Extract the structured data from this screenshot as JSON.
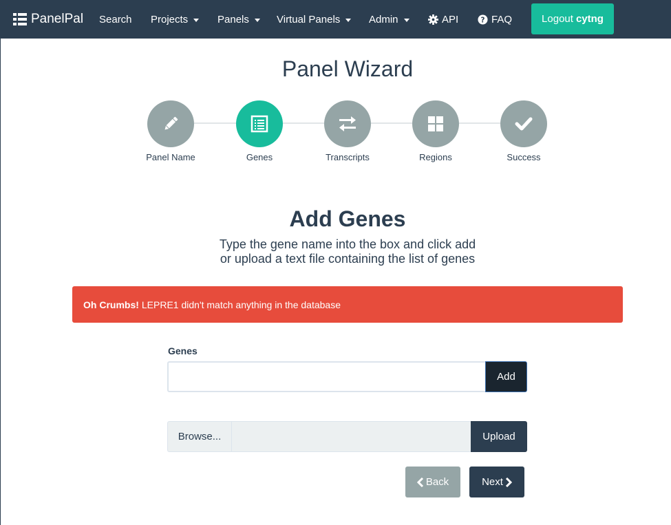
{
  "navbar": {
    "brand": "PanelPal",
    "search": "Search",
    "projects": "Projects",
    "panels": "Panels",
    "virtual_panels": "Virtual Panels",
    "admin": "Admin",
    "api": "API",
    "faq": "FAQ",
    "logout_prefix": "Logout",
    "username": "cytng"
  },
  "wizard": {
    "title": "Panel Wizard",
    "steps": [
      {
        "label": "Panel Name",
        "icon": "pencil-icon",
        "active": false
      },
      {
        "label": "Genes",
        "icon": "list-icon",
        "active": true
      },
      {
        "label": "Transcripts",
        "icon": "exchange-icon",
        "active": false
      },
      {
        "label": "Regions",
        "icon": "grid-icon",
        "active": false
      },
      {
        "label": "Success",
        "icon": "check-icon",
        "active": false
      }
    ]
  },
  "section": {
    "title": "Add Genes",
    "desc_line1": "Type the gene name into the box and click add",
    "desc_line2": "or upload a text file containing the list of genes"
  },
  "alert": {
    "strong": "Oh Crumbs!",
    "message": "LEPRE1 didn't match anything in the database"
  },
  "form": {
    "genes_label": "Genes",
    "genes_value": "",
    "add_label": "Add",
    "browse_label": "Browse...",
    "upload_label": "Upload",
    "back_label": "Back",
    "next_label": "Next"
  },
  "colors": {
    "primary": "#2c3e50",
    "success": "#18bc9c",
    "danger": "#e74c3c",
    "muted": "#95a5a6"
  }
}
